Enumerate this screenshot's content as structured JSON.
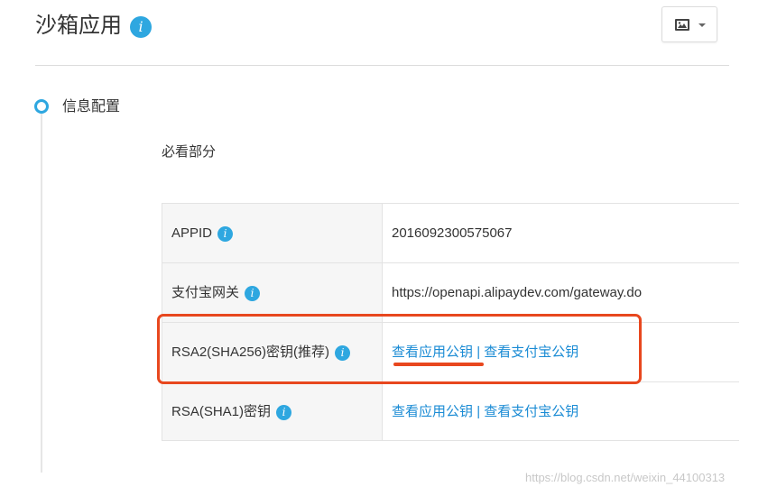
{
  "header": {
    "title": "沙箱应用",
    "info_glyph": "i",
    "image_button_icon": "image-icon"
  },
  "section": {
    "title": "信息配置",
    "subtitle": "必看部分"
  },
  "table": {
    "rows": [
      {
        "label": "APPID",
        "value": "2016092300575067"
      },
      {
        "label": "支付宝网关",
        "value": "https://openapi.alipaydev.com/gateway.do"
      },
      {
        "label": "RSA2(SHA256)密钥(推荐)",
        "link_app": "查看应用公钥",
        "separator": "|",
        "link_alipay": "查看支付宝公钥"
      },
      {
        "label": "RSA(SHA1)密钥",
        "link_app": "查看应用公钥",
        "separator": "|",
        "link_alipay": "查看支付宝公钥"
      }
    ]
  },
  "watermark": "https://blog.csdn.net/weixin_44100313",
  "colors": {
    "accent": "#2ea7e0",
    "link": "#1a8bd4",
    "annotation": "#e8471e"
  }
}
